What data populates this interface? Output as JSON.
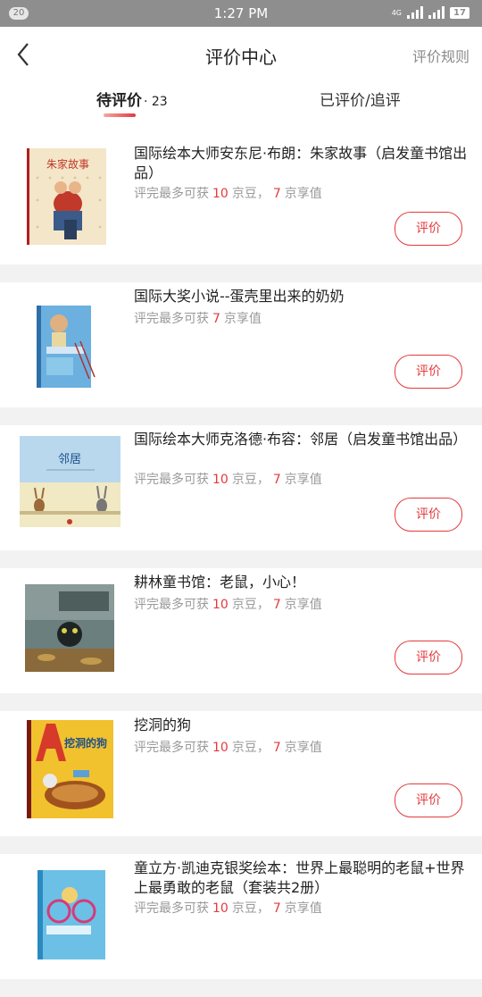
{
  "status_bar": {
    "badge": "20",
    "time": "1:27 PM",
    "network": "4G",
    "battery": "17"
  },
  "header": {
    "title": "评价中心",
    "rules_link": "评价规则"
  },
  "tabs": {
    "pending_label": "待评价",
    "pending_count": "· 23",
    "done_label": "已评价/追评"
  },
  "common": {
    "reward_prefix": "评完最多可获",
    "beans_unit": "京豆，",
    "enjoy_unit": "京享值",
    "review_button": "评价"
  },
  "items": [
    {
      "title": "国际绘本大师安东尼·布朗：朱家故事（启发童书馆出品）",
      "beans": "10",
      "enjoy": "7",
      "cover_text": "朱家故事"
    },
    {
      "title": "国际大奖小说--蛋壳里出来的奶奶",
      "enjoy": "7"
    },
    {
      "title": "国际绘本大师克洛德·布容：邻居（启发童书馆出品）",
      "beans": "10",
      "enjoy": "7",
      "cover_text": "邻居"
    },
    {
      "title": "耕林童书馆：老鼠，小心！",
      "beans": "10",
      "enjoy": "7"
    },
    {
      "title": "挖洞的狗",
      "beans": "10",
      "enjoy": "7",
      "cover_text": "挖洞的狗"
    },
    {
      "title": "童立方·凯迪克银奖绘本：世界上最聪明的老鼠+世界上最勇敢的老鼠（套装共2册）",
      "beans": "10",
      "enjoy": "7"
    }
  ]
}
